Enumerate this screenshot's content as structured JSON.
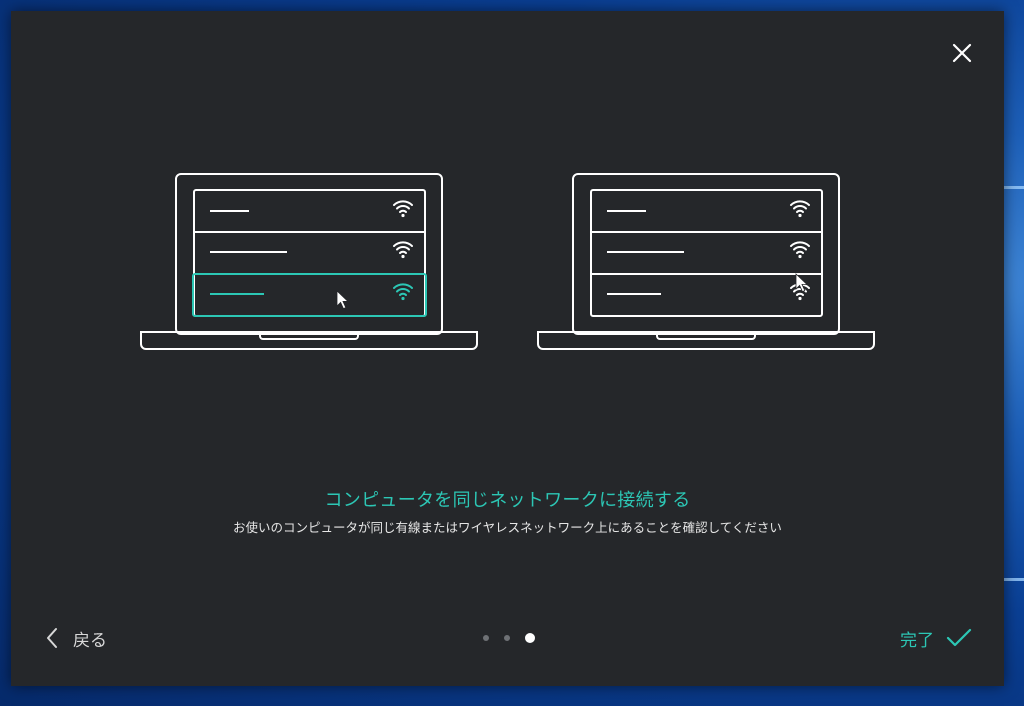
{
  "dialog": {
    "title": "コンピュータを同じネットワークに接続する",
    "description": "お使いのコンピュータが同じ有線またはワイヤレスネットワーク上にあることを確認してください",
    "back_label": "戻る",
    "done_label": "完了",
    "pagination": {
      "total": 3,
      "current": 3
    }
  },
  "colors": {
    "accent": "#2cc7b5",
    "dialog_bg": "#25272a",
    "line": "#ffffff"
  },
  "icons": {
    "close": "close-icon",
    "back": "chevron-left-icon",
    "done": "checkmark-icon",
    "wifi": "wifi-icon",
    "cursor": "mouse-pointer-icon"
  }
}
